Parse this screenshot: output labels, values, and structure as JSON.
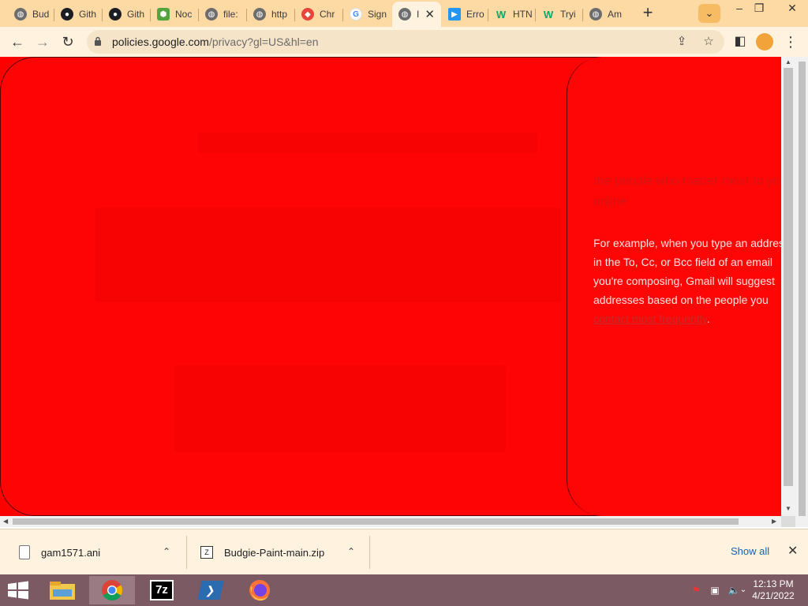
{
  "tabs": [
    {
      "title": "Bud",
      "icon": "globe-icon"
    },
    {
      "title": "Gith",
      "icon": "github-icon"
    },
    {
      "title": "Gith",
      "icon": "github-icon"
    },
    {
      "title": "Noc",
      "icon": "nodejs-icon"
    },
    {
      "title": "file:",
      "icon": "globe-icon"
    },
    {
      "title": "http",
      "icon": "globe-icon"
    },
    {
      "title": "Chr",
      "icon": "chrome-web-store-icon"
    },
    {
      "title": "Sign",
      "icon": "google-icon"
    },
    {
      "title": "I",
      "icon": "globe-icon",
      "active": true
    },
    {
      "title": "Erro",
      "icon": "play-icon"
    },
    {
      "title": "HTN",
      "icon": "w3schools-icon"
    },
    {
      "title": "Tryi",
      "icon": "w3schools-icon"
    },
    {
      "title": "Am",
      "icon": "globe-icon"
    }
  ],
  "window_controls": {
    "minimize": "–",
    "restore": "❐",
    "close": "✕"
  },
  "toolbar": {
    "url_host": "policies.google.com",
    "url_path": "/privacy?gl=US&hl=en"
  },
  "page": {
    "heading": "the people who matter most to you online",
    "body_before_link": "For example, when you type an address in the To, Cc, or Bcc field of an email you're composing, Gmail will suggest addresses based on the people you ",
    "body_link": "contact most frequently",
    "body_after_link": "."
  },
  "downloads": {
    "items": [
      {
        "filename": "gam1571.ani",
        "icon": "file-icon"
      },
      {
        "filename": "Budgie-Paint-main.zip",
        "icon": "zip-icon"
      }
    ],
    "show_all_label": "Show all"
  },
  "taskbar": {
    "apps": [
      "file-explorer-icon",
      "chrome-icon",
      "7zip-icon",
      "powershell-icon",
      "firefox-icon"
    ],
    "time": "12:13 PM",
    "date": "4/21/2022"
  },
  "colors": {
    "tabstrip": "#fdd9a4",
    "page_background": "#ff0000",
    "taskbar": "#7b5a64"
  }
}
